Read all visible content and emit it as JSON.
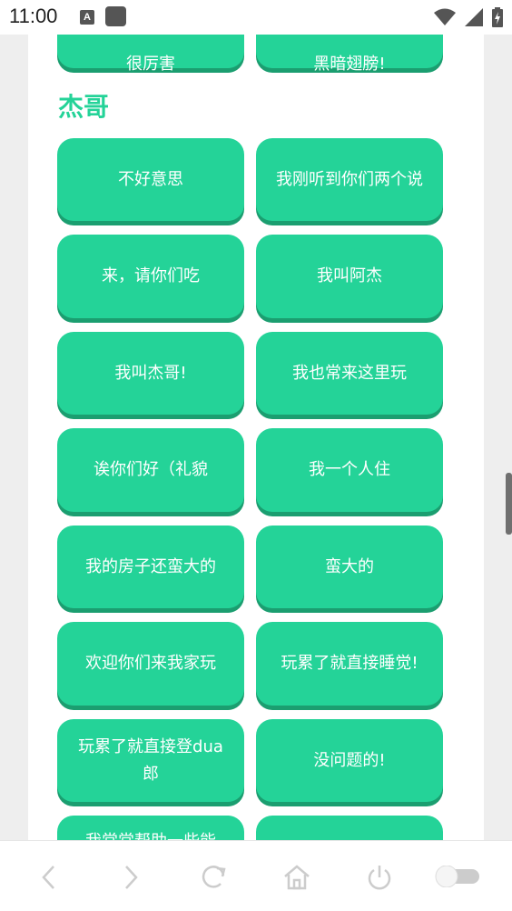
{
  "status_bar": {
    "time": "11:00",
    "a_icon_letter": "A",
    "icons": [
      "a-notification-icon",
      "square-notification-icon",
      "wifi-icon",
      "signal-icon",
      "battery-charging-icon"
    ]
  },
  "section": {
    "title": "杰哥"
  },
  "top_partial_buttons": [
    {
      "label": "很厉害"
    },
    {
      "label": "黑暗翅膀!"
    }
  ],
  "phrases": [
    {
      "label": "不好意思"
    },
    {
      "label": "我刚听到你们两个说"
    },
    {
      "label": "来，请你们吃"
    },
    {
      "label": "我叫阿杰"
    },
    {
      "label": "我叫杰哥!"
    },
    {
      "label": "我也常来这里玩"
    },
    {
      "label": "诶你们好（礼貌"
    },
    {
      "label": "我一个人住"
    },
    {
      "label": "我的房子还蛮大的"
    },
    {
      "label": "蛮大的"
    },
    {
      "label": "欢迎你们来我家玩"
    },
    {
      "label": "玩累了就直接睡觉!"
    },
    {
      "label": "玩累了就直接登dua郎"
    },
    {
      "label": "没问题的!"
    }
  ],
  "bottom_partial_buttons": [
    {
      "label": "我常常帮助一些能"
    },
    {
      "label": ""
    }
  ],
  "bottom_nav": {
    "items": [
      "back-icon",
      "forward-icon",
      "refresh-icon",
      "home-icon",
      "power-icon",
      "toggle-switch"
    ]
  },
  "colors": {
    "accent": "#24d398",
    "accent_shadow": "#1b9e70",
    "nav_icon": "#cccccc"
  }
}
